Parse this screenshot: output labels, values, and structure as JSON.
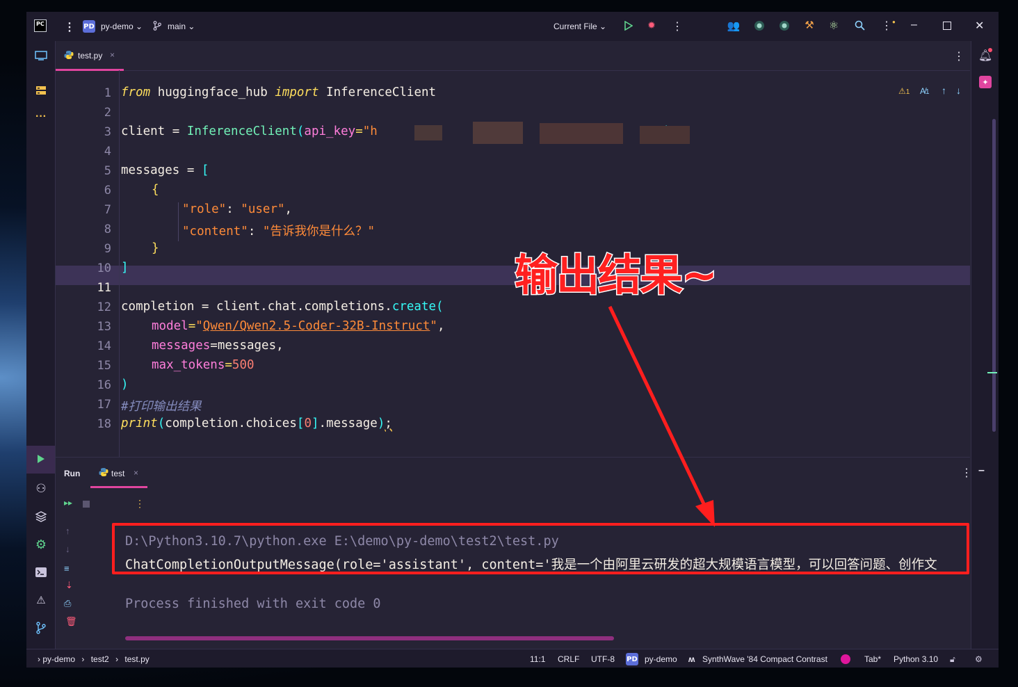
{
  "titlebar": {
    "logo": "PC",
    "project_badge": "PD",
    "project_name": "py-demo",
    "branch": "main",
    "run_config": "Current File"
  },
  "editor": {
    "tab_name": "test.py",
    "warnings": "1",
    "typos": "1",
    "line_numbers": [
      "1",
      "2",
      "3",
      "4",
      "5",
      "6",
      "7",
      "8",
      "9",
      "10",
      "11",
      "12",
      "13",
      "14",
      "15",
      "16",
      "17",
      "18"
    ],
    "code": {
      "l1_from": "from",
      "l1_mod": " huggingface_hub ",
      "l1_import": "import",
      "l1_cls": " InferenceClient",
      "l3_var": "client = ",
      "l3_cls": "InferenceClient",
      "l3_open": "(",
      "l3_param": "api_key",
      "l3_eq": "=",
      "l3_str": "\"h",
      "l3_str_end": "\"",
      "l3_close": ")",
      "l5_var": "messages = ",
      "l5_br": "[",
      "l6": "{",
      "l7_key": "\"role\"",
      "l7_colon": ": ",
      "l7_val": "\"user\"",
      "l7_comma": ",",
      "l8_key": "\"content\"",
      "l8_colon": ": ",
      "l8_val": "\"告诉我你是什么？\"",
      "l9": "}",
      "l10": "]",
      "l12_a": "completion = client.chat.completions.",
      "l12_fn": "create",
      "l12_br": "(",
      "l13_param": "model",
      "l13_eq": "=",
      "l13_q1": "\"",
      "l13_str": "Qwen/Qwen2.5-Coder-32B-Instruct",
      "l13_q2": "\"",
      "l13_comma": ",",
      "l14_param": "messages",
      "l14_rest": "=messages,",
      "l15_param": "max_tokens",
      "l15_eq": "=",
      "l15_num": "500",
      "l16": ")",
      "l17": "#打印输出结果",
      "l18_fn": "print",
      "l18_open": "(",
      "l18_mid": "completion.choices",
      "l18_b1": "[",
      "l18_idx": "0",
      "l18_b2": "]",
      "l18_end": ".message",
      "l18_close": ")",
      "l18_semi": ";"
    }
  },
  "run": {
    "panel_label": "Run",
    "tab_name": "test",
    "console": {
      "line1": "D:\\Python3.10.7\\python.exe E:\\demo\\py-demo\\test2\\test.py",
      "line2": "ChatCompletionOutputMessage(role='assistant', content='我是一个由阿里云研发的超大规模语言模型，可以回答问题、创作文",
      "line3": "Process finished with exit code 0"
    }
  },
  "annotation": {
    "text": "输出结果~",
    "color": "#ff2020"
  },
  "statusbar": {
    "breadcrumb_project": "py-demo",
    "breadcrumb_folder": "test2",
    "breadcrumb_file": "test.py",
    "position": "11:1",
    "line_sep": "CRLF",
    "encoding": "UTF-8",
    "project_badge": "PD",
    "project_name": "py-demo",
    "theme": "SynthWave '84 Compact Contrast",
    "indent": "Tab*",
    "interpreter": "Python 3.10"
  },
  "colors": {
    "accent": "#e0459f",
    "bg": "#262335",
    "chrome": "#1e1b2c"
  }
}
